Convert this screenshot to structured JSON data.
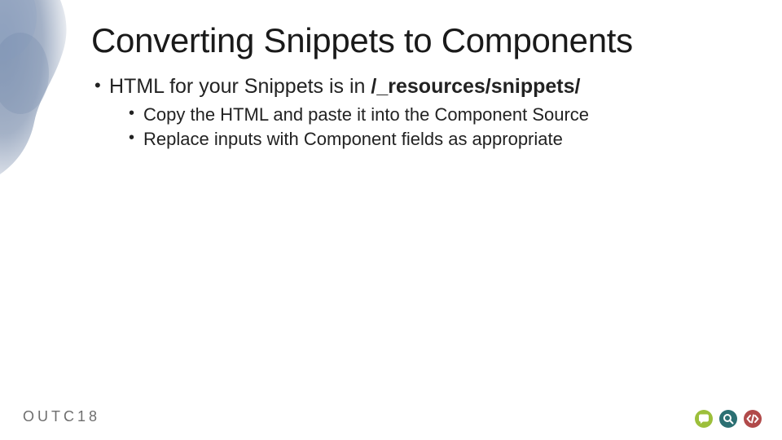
{
  "title": "Converting Snippets to Components",
  "bullet1_prefix": "HTML for your Snippets is in ",
  "bullet1_bold": "/_resources/snippets/",
  "sub_bullets": [
    "Copy the HTML and paste it into the Component Source",
    "Replace inputs with Component fields as appropriate"
  ],
  "footer_brand": "OUTC18",
  "icons": {
    "speech": "speech-bubble-icon",
    "search": "magnifier-icon",
    "code": "code-brackets-icon"
  },
  "colors": {
    "icon_green": "#9cbf3b",
    "icon_teal": "#2b6f72",
    "icon_red": "#b14a4a",
    "brand_gray": "#6e6e6e",
    "splash": "#5b7399"
  }
}
